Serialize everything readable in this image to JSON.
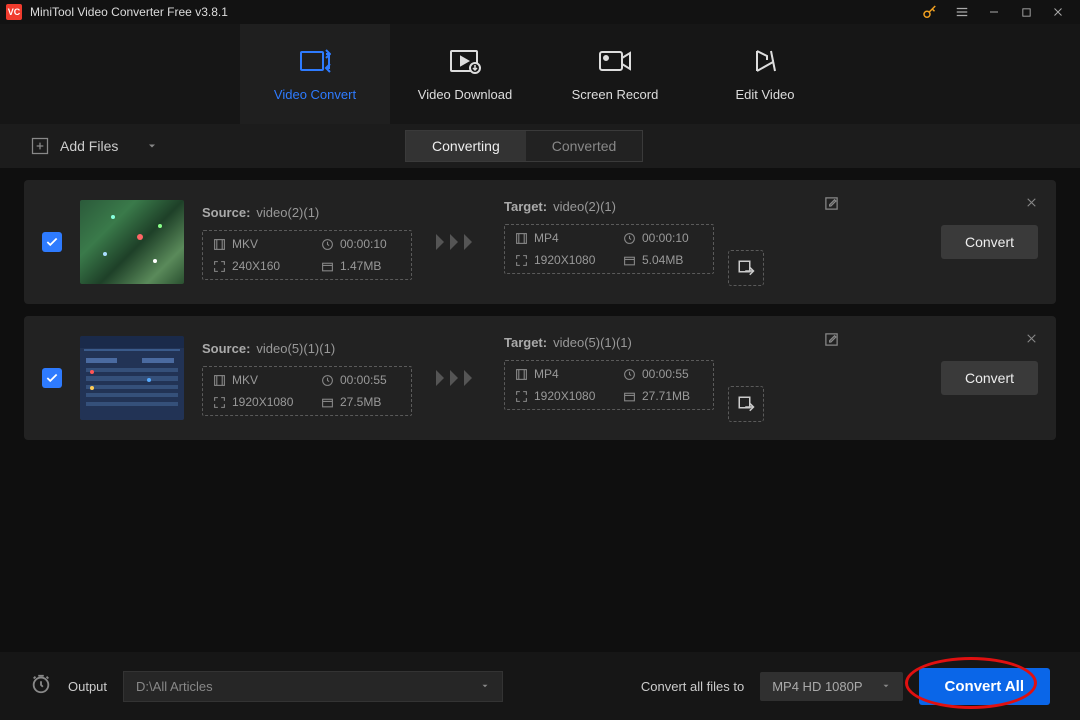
{
  "app": {
    "title": "MiniTool Video Converter Free v3.8.1"
  },
  "mainTabs": {
    "convert": "Video Convert",
    "download": "Video Download",
    "record": "Screen Record",
    "edit": "Edit Video"
  },
  "subbar": {
    "addFiles": "Add Files",
    "segConverting": "Converting",
    "segConverted": "Converted"
  },
  "labels": {
    "source": "Source:",
    "target": "Target:",
    "convertBtn": "Convert"
  },
  "files": [
    {
      "checked": true,
      "sourceName": "video(2)(1)",
      "targetName": "video(2)(1)",
      "src": {
        "format": "MKV",
        "duration": "00:00:10",
        "resolution": "240X160",
        "size": "1.47MB"
      },
      "tgt": {
        "format": "MP4",
        "duration": "00:00:10",
        "resolution": "1920X1080",
        "size": "5.04MB"
      }
    },
    {
      "checked": true,
      "sourceName": "video(5)(1)(1)",
      "targetName": "video(5)(1)(1)",
      "src": {
        "format": "MKV",
        "duration": "00:00:55",
        "resolution": "1920X1080",
        "size": "27.5MB"
      },
      "tgt": {
        "format": "MP4",
        "duration": "00:00:55",
        "resolution": "1920X1080",
        "size": "27.71MB"
      }
    }
  ],
  "bottom": {
    "outputLabel": "Output",
    "outputPath": "D:\\All Articles",
    "convertAllLabel": "Convert all files to",
    "formatPreset": "MP4 HD 1080P",
    "convertAllBtn": "Convert All"
  }
}
